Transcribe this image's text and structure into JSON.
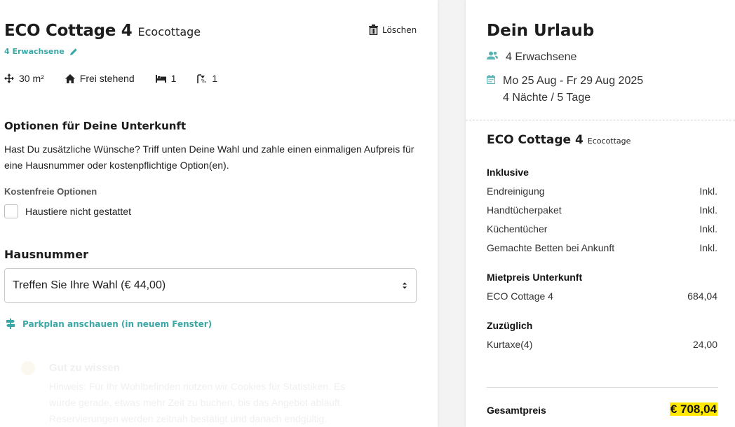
{
  "booking": {
    "cottage_name": "ECO Cottage 4",
    "cottage_type": "Ecocottage",
    "delete_label": "Löschen",
    "guests_link": "4 Erwachsene",
    "features": {
      "area": "30 m²",
      "house_type": "Frei stehend",
      "bedrooms": "1",
      "bathrooms": "1"
    },
    "options_heading": "Optionen für Deine Unterkunft",
    "options_text": "Hast Du zusätzliche Wünsche? Triff unten Deine Wahl und zahle einen einmaligen Aufpreis für eine Hausnummer oder kostenpflichtige Option(en).",
    "free_options_heading": "Kostenfreie Optionen",
    "free_options": [
      {
        "label": "Haustiere nicht gestattet",
        "checked": false
      }
    ],
    "house_number_heading": "Hausnummer",
    "house_number_select": "Treffen Sie Ihre Wahl (€ 44,00)",
    "park_plan_link": "Parkplan anschauen (in neuem Fenster)",
    "faded_section": {
      "title": "Gut zu wissen",
      "lines": [
        "Hinweis: Für Ihr Wohlbefinden nutzen wir Cookies für Statistiken. Es",
        "wurde gerade, etwas mehr Zeit zu buchen, bis das Angebot abläuft.",
        "Reservierungen werden zeitnah bestätigt und danach endgültig."
      ]
    }
  },
  "summary": {
    "title": "Dein Urlaub",
    "guests": "4 Erwachsene",
    "dates": "Mo 25 Aug - Fr 29 Aug 2025",
    "duration": "4 Nächte / 5 Tage",
    "cottage_name": "ECO Cottage 4",
    "cottage_type": "Ecocottage",
    "inclusive_heading": "Inklusive",
    "inclusive_items": [
      {
        "label": "Endreinigung",
        "value": "Inkl."
      },
      {
        "label": "Handtücherpaket",
        "value": "Inkl."
      },
      {
        "label": "Küchentücher",
        "value": "Inkl."
      },
      {
        "label": "Gemachte Betten bei Ankunft",
        "value": "Inkl."
      }
    ],
    "rent_heading": "Mietpreis Unterkunft",
    "rent_items": [
      {
        "label": "ECO Cottage 4",
        "value": "684,04"
      }
    ],
    "extra_heading": "Zuzüglich",
    "extra_items": [
      {
        "label": "Kurtaxe(4)",
        "value": "24,00"
      }
    ],
    "total_label": "Gesamtpreis",
    "total_value": "€ 708,04"
  },
  "colors": {
    "accent": "#3ba7a6",
    "highlight": "#ffe800",
    "icon_teal": "#5bb3b3"
  },
  "icons": [
    "trash-icon",
    "pencil-icon",
    "move-arrows-icon",
    "house-icon",
    "bed-icon",
    "shower-icon",
    "users-icon",
    "calendar-icon",
    "signpost-icon",
    "select-arrows-icon"
  ]
}
